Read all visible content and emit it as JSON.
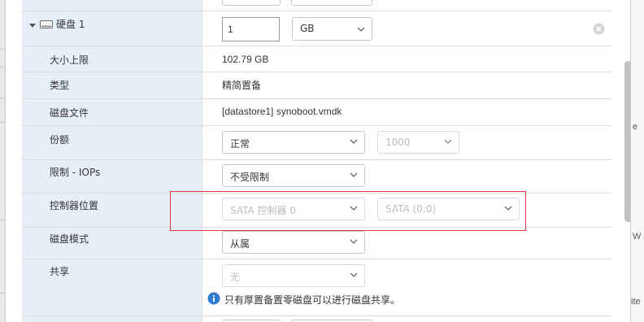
{
  "disk": {
    "title": "硬盘 1",
    "size_value": "1",
    "size_unit": "GB"
  },
  "rows": {
    "max_size": {
      "label": "大小上限",
      "value": "102.79 GB"
    },
    "type": {
      "label": "类型",
      "value": "精简置备"
    },
    "disk_file": {
      "label": "磁盘文件",
      "value": "[datastore1] synoboot.vmdk"
    },
    "shares": {
      "label": "份额",
      "level": "正常",
      "amount": "1000"
    },
    "limit_iops": {
      "label": "限制 - IOPs",
      "value": "不受限制"
    },
    "controller": {
      "label": "控制器位置",
      "controller": "SATA 控制器 0",
      "slot": "SATA (0:0)"
    },
    "disk_mode": {
      "label": "磁盘模式",
      "value": "从属"
    },
    "sharing": {
      "label": "共享",
      "value": "无",
      "hint": "只有厚置备置零磁盘可以进行磁盘共享。"
    }
  },
  "background": {
    "right_texts": [
      "e",
      "W",
      "ite"
    ]
  },
  "colors": {
    "label_bg": "#e6eff7",
    "highlight_border": "#e0363b",
    "info_icon": "#2e7dd1"
  }
}
